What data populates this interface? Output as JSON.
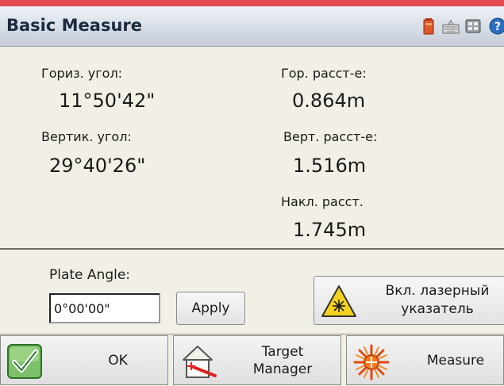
{
  "window": {
    "title": "Basic Measure",
    "system_icons": [
      "battery-icon",
      "keyboard-icon",
      "device-icon",
      "help-icon"
    ]
  },
  "readings": {
    "hz_angle": {
      "label": "Гориз. угол:",
      "value": "11°50'42\""
    },
    "v_angle": {
      "label": "Вертик. угол:",
      "value": "29°40'26\""
    },
    "hz_dist": {
      "label": "Гор. расст-е:",
      "value": "0.864m"
    },
    "v_dist": {
      "label": "Верт. расст-е:",
      "value": "1.516m"
    },
    "slope_dist": {
      "label": "Накл. расст.",
      "value": "1.745m"
    }
  },
  "plate": {
    "label": "Plate Angle:",
    "value": "0°00'00\"",
    "apply_label": "Apply"
  },
  "laser": {
    "label_line1": "Вкл. лазерный",
    "label_line2": "указатель"
  },
  "bottom": {
    "ok_label": "OK",
    "target_line1": "Target",
    "target_line2": "Manager",
    "measure_label": "Measure"
  },
  "colors": {
    "top_strip": "#e44a52",
    "background": "#f2f0e6",
    "ok_check_green": "#3a9a3a",
    "warning_yellow": "#f5d21e"
  }
}
